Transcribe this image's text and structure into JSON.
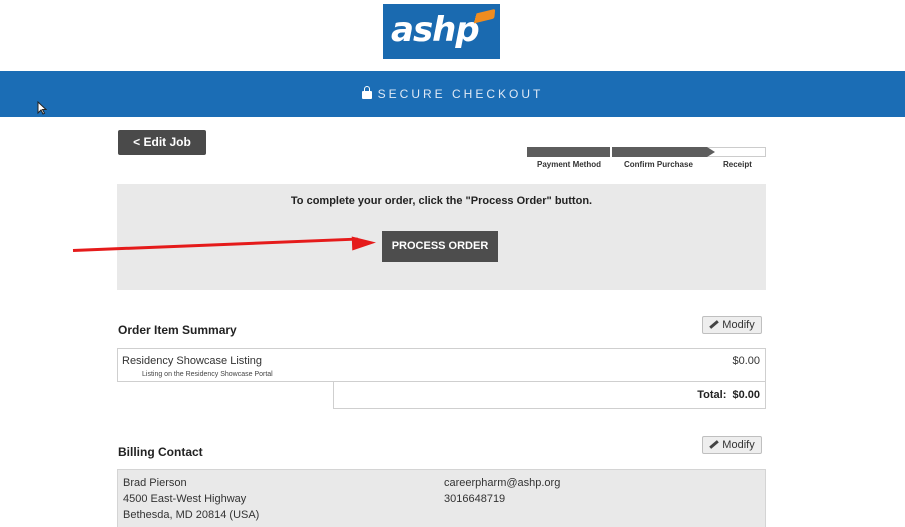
{
  "logo": {
    "text": "ashp"
  },
  "banner": {
    "label": "SECURE CHECKOUT"
  },
  "nav": {
    "edit_job_label": "< Edit Job"
  },
  "progress": {
    "steps": [
      "Payment Method",
      "Confirm Purchase",
      "Receipt"
    ],
    "current_step": 2
  },
  "process": {
    "instructions": "To complete your order, click the \"Process Order\" button.",
    "button_label": "PROCESS ORDER"
  },
  "order_summary": {
    "title": "Order Item Summary",
    "modify_label": "Modify",
    "items": [
      {
        "name": "Residency Showcase Listing",
        "description": "Listing on the Residency Showcase Portal",
        "price": "$0.00"
      }
    ],
    "total": "Total:  $0.00"
  },
  "billing": {
    "title": "Billing Contact",
    "modify_label": "Modify",
    "name": "Brad Pierson",
    "address_line1": "4500 East-West Highway",
    "address_line2": "Bethesda, MD 20814 (USA)",
    "email": "careerpharm@ashp.org",
    "phone": "3016648719"
  },
  "colors": {
    "banner": "#1b6db5",
    "button_dark": "#4d4d4d",
    "panel": "#e9e9e9",
    "annotation_arrow": "#e51b1b",
    "logo_accent": "#f08c1f"
  }
}
